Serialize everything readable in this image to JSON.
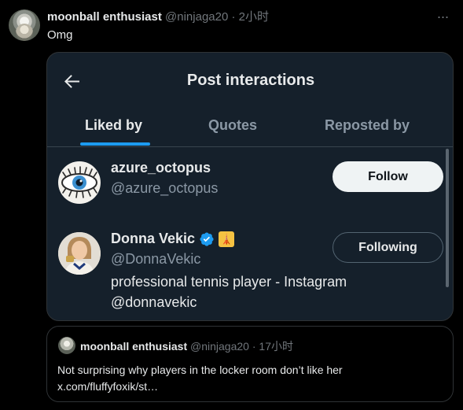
{
  "tweet": {
    "author_name": "moonball enthusiast",
    "author_handle": "@ninjaga20",
    "separator": "·",
    "time": "2小时",
    "more_label": "···",
    "text": "Omg"
  },
  "media": {
    "title": "Post interactions",
    "tabs": [
      {
        "label": "Liked by",
        "active": true
      },
      {
        "label": "Quotes",
        "active": false
      },
      {
        "label": "Reposted by",
        "active": false
      }
    ],
    "users": [
      {
        "name": "azure_octopus",
        "handle": "@azure_octopus",
        "bio": "",
        "button_label": "Follow",
        "verified": false
      },
      {
        "name": "Donna Vekic",
        "handle": "@DonnaVekic",
        "bio": "professional tennis player - Instagram @donnavekic",
        "button_label": "Following",
        "verified": true,
        "affiliate_badge": "🗼"
      }
    ]
  },
  "quote": {
    "author_name": "moonball enthusiast",
    "author_handle": "@ninjaga20",
    "separator": "·",
    "time": "17小时",
    "text_line1": "Not surprising why players in the locker room don’t like her",
    "text_line2": "x.com/fluffyfoxik/st…"
  },
  "colors": {
    "background": "#000000",
    "card_background": "#15202b",
    "accent": "#1d9bf0",
    "muted_text": "#71767b"
  }
}
